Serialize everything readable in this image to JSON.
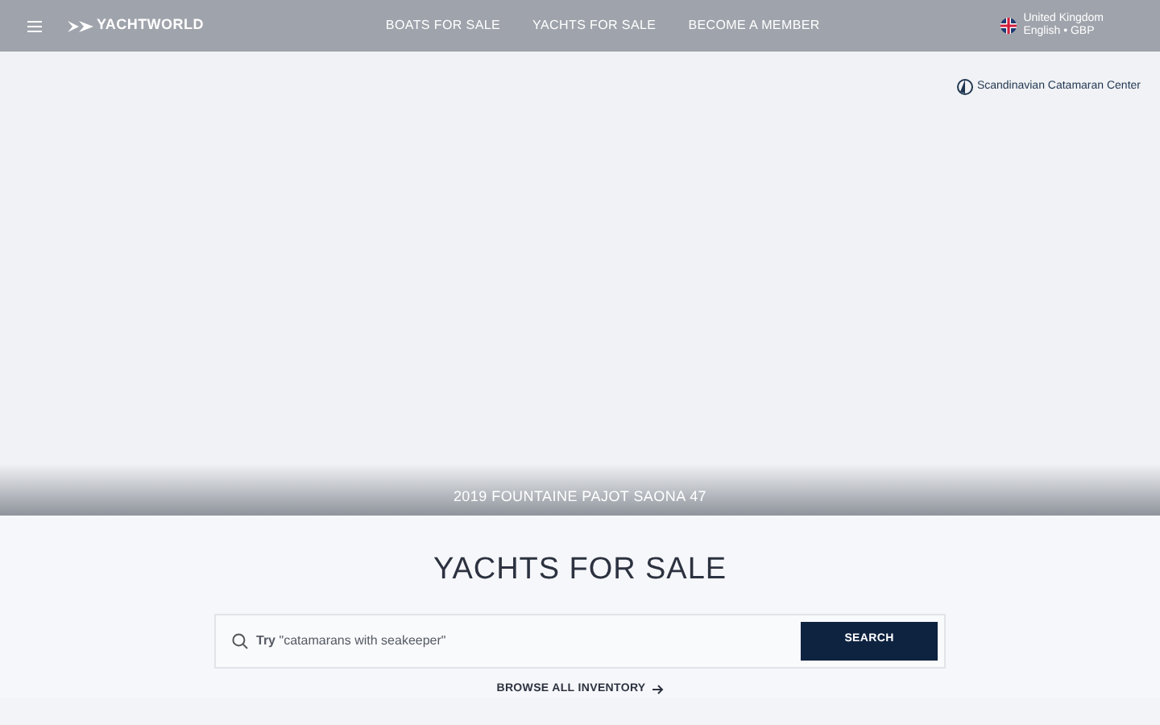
{
  "header": {
    "logo": "YACHTWORLD",
    "nav": [
      {
        "label": "BOATS FOR SALE"
      },
      {
        "label": "YACHTS FOR SALE"
      },
      {
        "label": "BECOME A MEMBER"
      }
    ],
    "locale": {
      "country": "United Kingdom",
      "language": "English • GBP"
    }
  },
  "hero": {
    "dealer": "Scandinavian Catamaran Center",
    "caption": "2019 FOUNTAINE PAJOT SAONA 47"
  },
  "search": {
    "title": "YACHTS FOR SALE",
    "placeholder": "**Try** \"catamarans with seakeeper\"",
    "button": "SEARCH",
    "browse": "BROWSE ALL INVENTORY"
  }
}
